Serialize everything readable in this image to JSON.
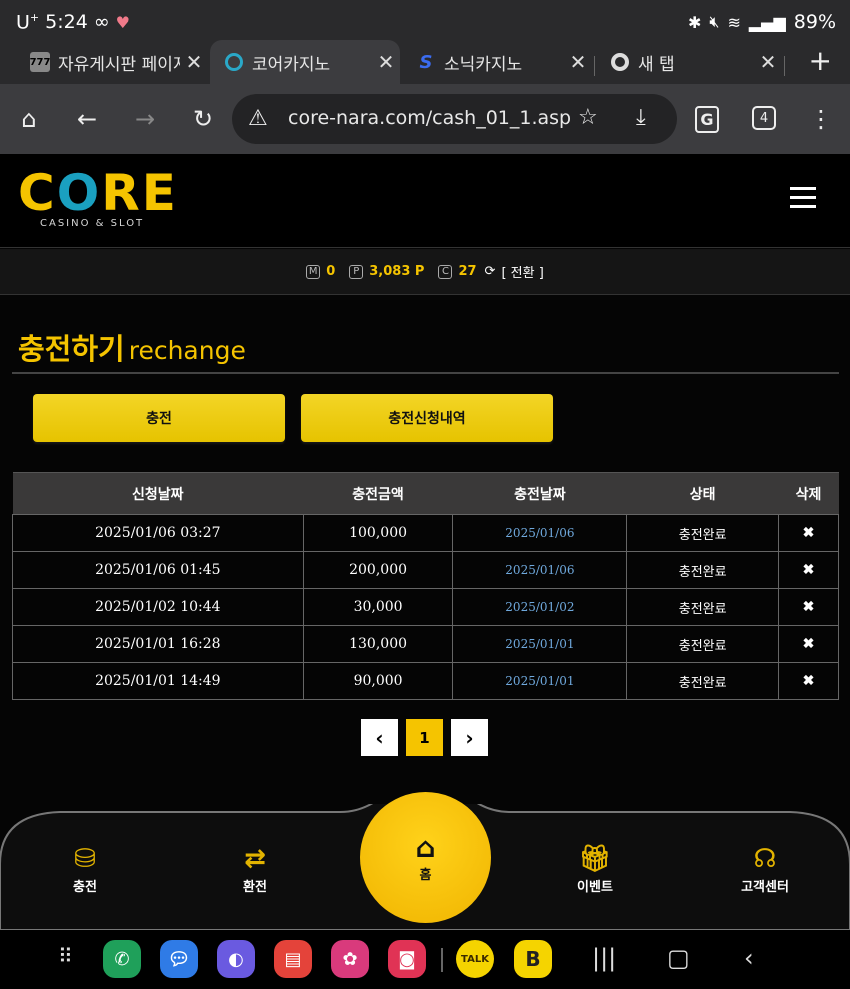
{
  "status_bar": {
    "carrier": "U",
    "carrier_sup": "+",
    "time": "5:24",
    "link_icon": "∞",
    "battery": "89%"
  },
  "tabs": [
    {
      "label": "자유게시판 페이지",
      "favicon": "slot-icon"
    },
    {
      "label": "코어카지노",
      "favicon": "circle-logo-icon"
    },
    {
      "label": "소닉카지노",
      "favicon": "s-logo-icon"
    },
    {
      "label": "새 탭",
      "favicon": "chrome-icon"
    }
  ],
  "toolbar": {
    "url": "core-nara.com/cash_01_1.asp",
    "tab_count": "4"
  },
  "site": {
    "logo_main": "CORE",
    "logo_sub": "CASINO & SLOT",
    "points": {
      "m_label": "M",
      "m_value": "0",
      "p_label": "P",
      "p_value": "3,083 P",
      "c_label": "C",
      "c_value": "27",
      "swap_label": "[ 전환 ]"
    },
    "title_ko": "충전하기",
    "title_en": "rechange",
    "buttons": {
      "charge": "충전",
      "history": "충전신청내역"
    },
    "table": {
      "headers": [
        "신청날짜",
        "충전금액",
        "충전날짜",
        "상태",
        "삭제"
      ],
      "rows": [
        [
          "2025/01/06 03:27",
          "100,000",
          "2025/01/06",
          "충전완료",
          "✖"
        ],
        [
          "2025/01/06 01:45",
          "200,000",
          "2025/01/06",
          "충전완료",
          "✖"
        ],
        [
          "2025/01/02 10:44",
          "30,000",
          "2025/01/02",
          "충전완료",
          "✖"
        ],
        [
          "2025/01/01 16:28",
          "130,000",
          "2025/01/01",
          "충전완료",
          "✖"
        ],
        [
          "2025/01/01 14:49",
          "90,000",
          "2025/01/01",
          "충전완료",
          "✖"
        ]
      ]
    },
    "pager": {
      "prev": "‹",
      "current": "1",
      "next": "›"
    },
    "bottom_nav": {
      "charge": "충전",
      "exchange": "환전",
      "home": "홈",
      "event": "이벤트",
      "support": "고객센터"
    }
  },
  "colors": {
    "accent": "#f5c400",
    "link_date": "#6fa8dc",
    "table_header": "#3a3939"
  }
}
